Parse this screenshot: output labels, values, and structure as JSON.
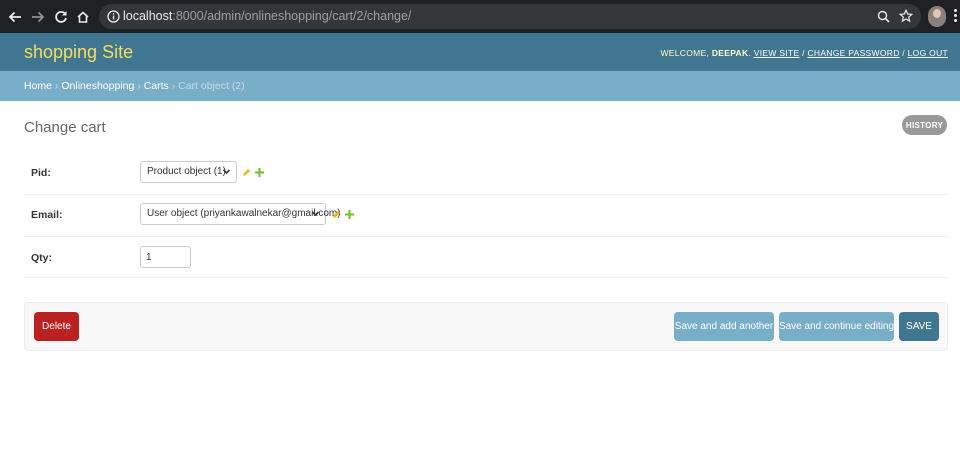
{
  "browser": {
    "url_host": "localhost",
    "url_path": ":8000/admin/onlineshopping/cart/2/change/"
  },
  "header": {
    "branding": "shopping Site",
    "welcome": "WELCOME,",
    "username": "DEEPAK",
    "view_site": "VIEW SITE",
    "change_password": "CHANGE PASSWORD",
    "log_out": "LOG OUT"
  },
  "breadcrumbs": {
    "home": "Home",
    "app": "Onlineshopping",
    "model": "Carts",
    "current": "Cart object (2)"
  },
  "page": {
    "title": "Change cart",
    "history": "HISTORY"
  },
  "form": {
    "pid_label": "Pid:",
    "pid_value": "Product object (1)",
    "email_label": "Email:",
    "email_value": "User object (priyankawalnekar@gmail.com)",
    "qty_label": "Qty:",
    "qty_value": "1"
  },
  "buttons": {
    "delete": "Delete",
    "save_add_another": "Save and add another",
    "save_continue": "Save and continue editing",
    "save": "SAVE"
  },
  "colors": {
    "header": "#417690",
    "breadcrumbs": "#79aec8",
    "branding": "#f5dd5d",
    "delete": "#ba2121"
  }
}
